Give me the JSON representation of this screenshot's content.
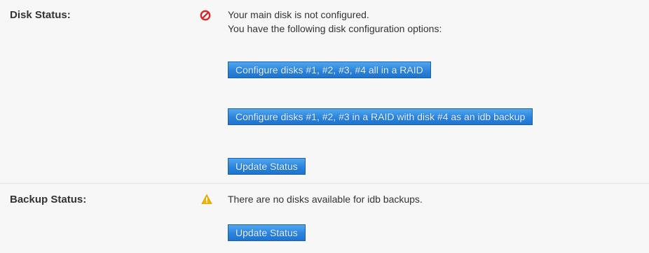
{
  "disk_status": {
    "label": "Disk Status:",
    "icon": "error-circle-icon",
    "icon_color": "#d42a2a",
    "message_line1": "Your main disk is not configured.",
    "message_line2": "You have the following disk configuration options:",
    "buttons": [
      "Configure disks #1, #2, #3, #4 all in a RAID",
      "Configure disks #1, #2, #3 in a RAID with disk #4 as an idb backup",
      "Update Status"
    ]
  },
  "backup_status": {
    "label": "Backup Status:",
    "icon": "warning-triangle-icon",
    "icon_color": "#f0b400",
    "message": "There are no disks available for idb backups.",
    "button": "Update Status"
  },
  "colors": {
    "button_bg": "#2b84dd",
    "row_bg": "#f7f7f7"
  }
}
